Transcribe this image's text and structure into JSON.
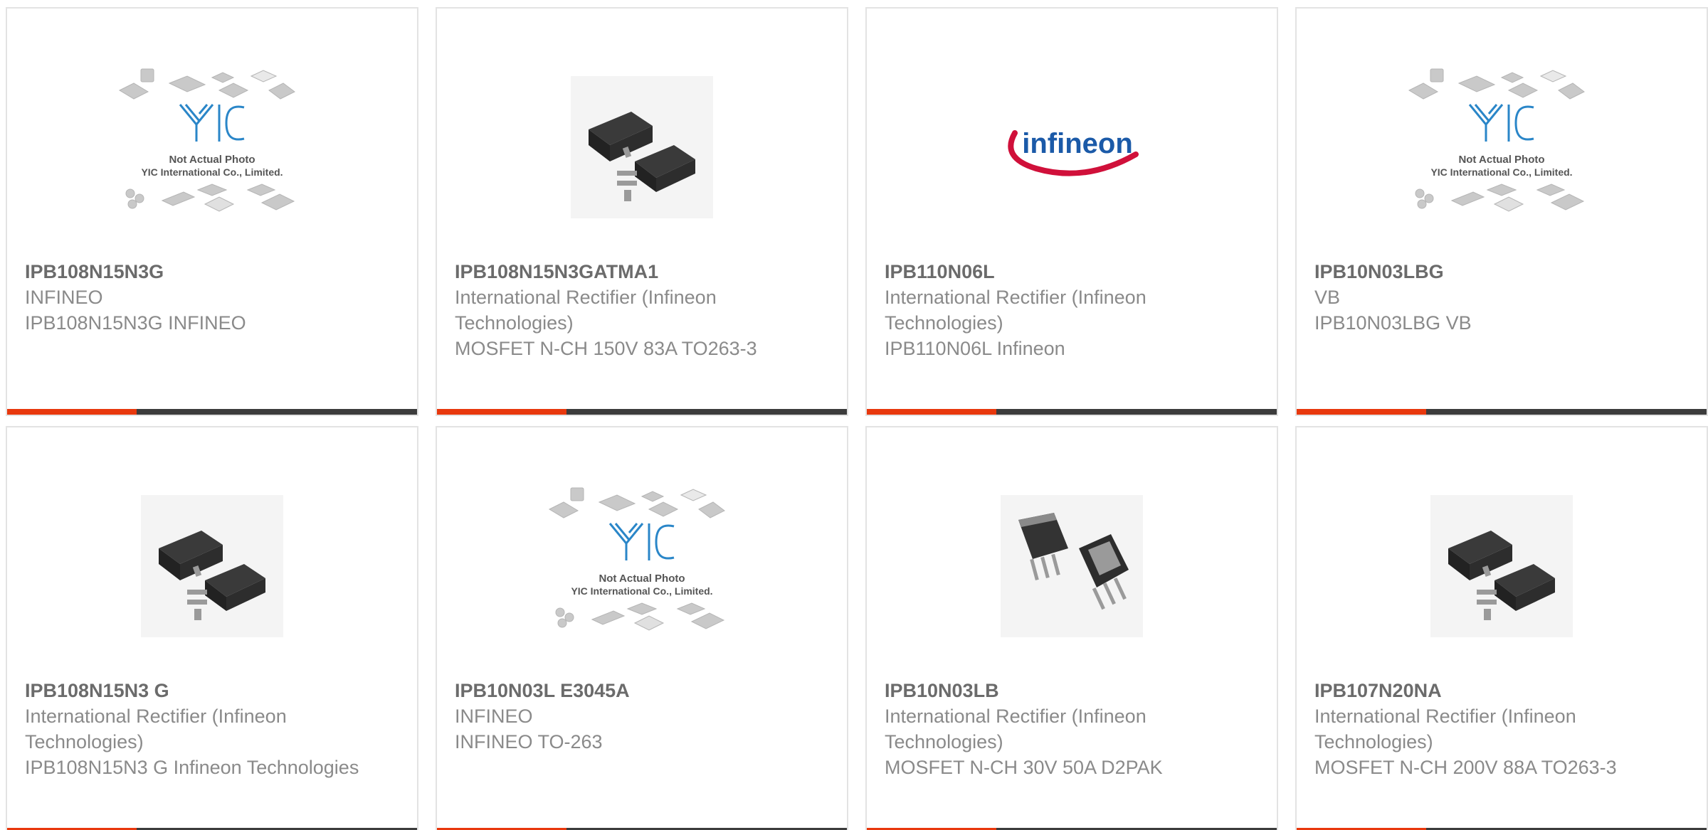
{
  "products": [
    {
      "part": "IPB108N15N3G",
      "maker": "INFINEO",
      "desc": "IPB108N15N3G INFINEO",
      "image": "yic-placeholder-icon"
    },
    {
      "part": "IPB108N15N3GATMA1",
      "maker": "International Rectifier (Infineon Technologies)",
      "desc": "MOSFET N-CH 150V 83A TO263-3",
      "image": "d2pak-package-icon"
    },
    {
      "part": "IPB110N06L",
      "maker": "International Rectifier (Infineon Technologies)",
      "desc": "IPB110N06L Infineon",
      "image": "infineon-logo"
    },
    {
      "part": "IPB10N03LBG",
      "maker": "VB",
      "desc": "IPB10N03LBG VB",
      "image": "yic-placeholder-icon"
    },
    {
      "part": "IPB108N15N3 G",
      "maker": "International Rectifier (Infineon Technologies)",
      "desc": "IPB108N15N3 G Infineon Technologies",
      "image": "d2pak-package-icon"
    },
    {
      "part": "IPB10N03L E3045A",
      "maker": "INFINEO",
      "desc": "INFINEO TO-263",
      "image": "yic-placeholder-icon"
    },
    {
      "part": "IPB10N03LB",
      "maker": "International Rectifier (Infineon Technologies)",
      "desc": "MOSFET N-CH 30V 50A D2PAK",
      "image": "to263-package-icon"
    },
    {
      "part": "IPB107N20NA",
      "maker": "International Rectifier (Infineon Technologies)",
      "desc": "MOSFET N-CH 200V 88A TO263-3",
      "image": "d2pak-package-icon"
    }
  ],
  "placeholder": {
    "line1": "Not Actual Photo",
    "line2": "YIC International Co., Limited.",
    "logo": "YIC"
  },
  "brand_logo_text": "infineon",
  "colors": {
    "accent": "#e8380d",
    "bar": "#3c3c3c",
    "border": "#e3e3e3",
    "part_text": "#6b6b6b",
    "meta_text": "#8a8a8a",
    "yic_blue": "#2a86c8",
    "infineon_red": "#d0103a",
    "infineon_blue": "#1b5aa8"
  }
}
